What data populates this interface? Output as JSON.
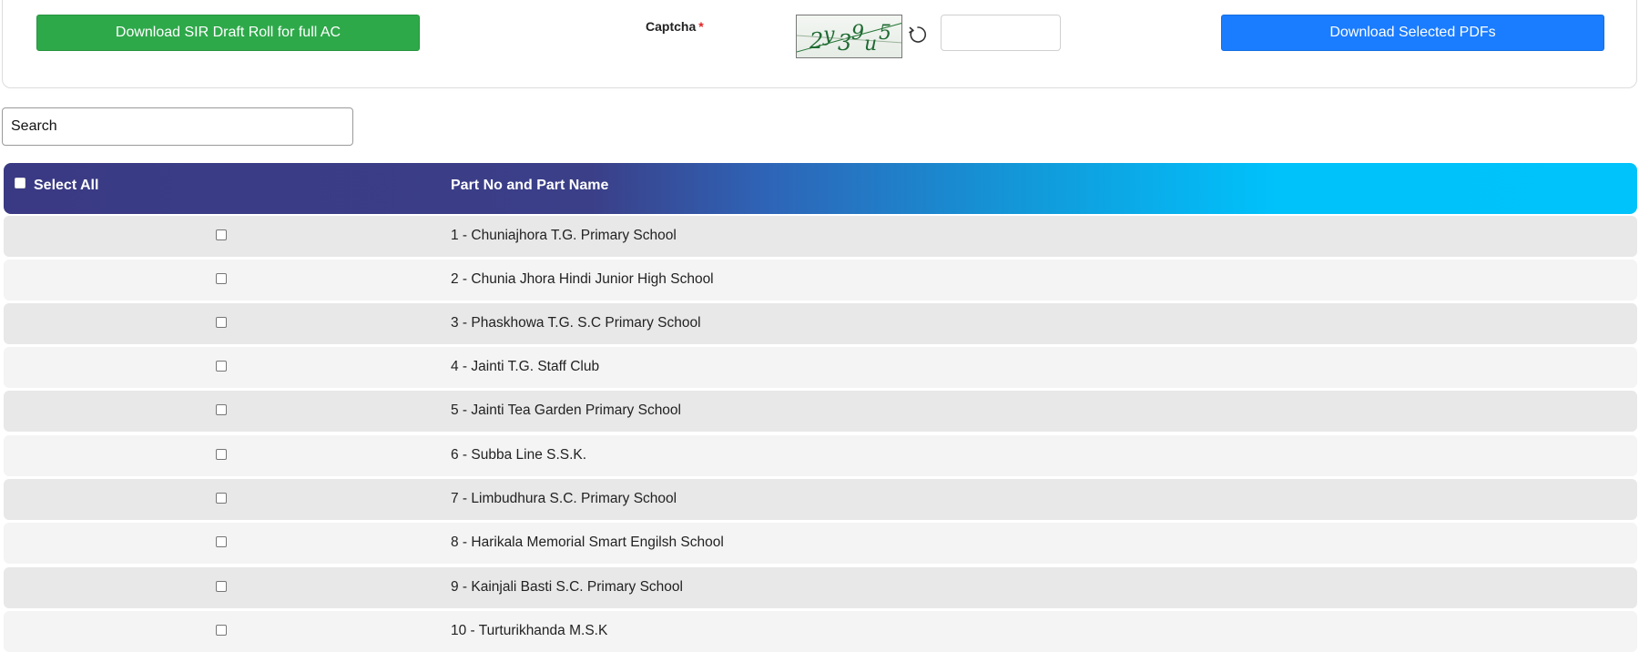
{
  "toolbar": {
    "download_full_label": "Download SIR Draft Roll for full AC",
    "download_selected_label": "Download Selected PDFs"
  },
  "captcha": {
    "label": "Captcha",
    "required_mark": "*",
    "image_text": "2y39u5",
    "refresh_icon": "refresh-icon",
    "input_value": ""
  },
  "search": {
    "placeholder": "Search",
    "value": ""
  },
  "table": {
    "header": {
      "select_all": "Select All",
      "part_column": "Part No and Part Name"
    },
    "rows": [
      "1 - Chuniajhora T.G. Primary School",
      "2 - Chunia Jhora Hindi Junior High School",
      "3 - Phaskhowa T.G. S.C Primary School",
      "4 - Jainti T.G. Staff Club",
      "5 - Jainti Tea Garden Primary School",
      "6 - Subba Line S.S.K.",
      "7 - Limbudhura S.C. Primary School",
      "8 - Harikala Memorial Smart Engilsh School",
      "9 - Kainjali Basti S.C. Primary School",
      "10 - Turturikhanda M.S.K"
    ]
  },
  "colors": {
    "green_button": "#2ea94a",
    "blue_button": "#1a7cff",
    "header_start": "#3a3a84",
    "header_end": "#00c3fb",
    "required": "#e02424"
  }
}
